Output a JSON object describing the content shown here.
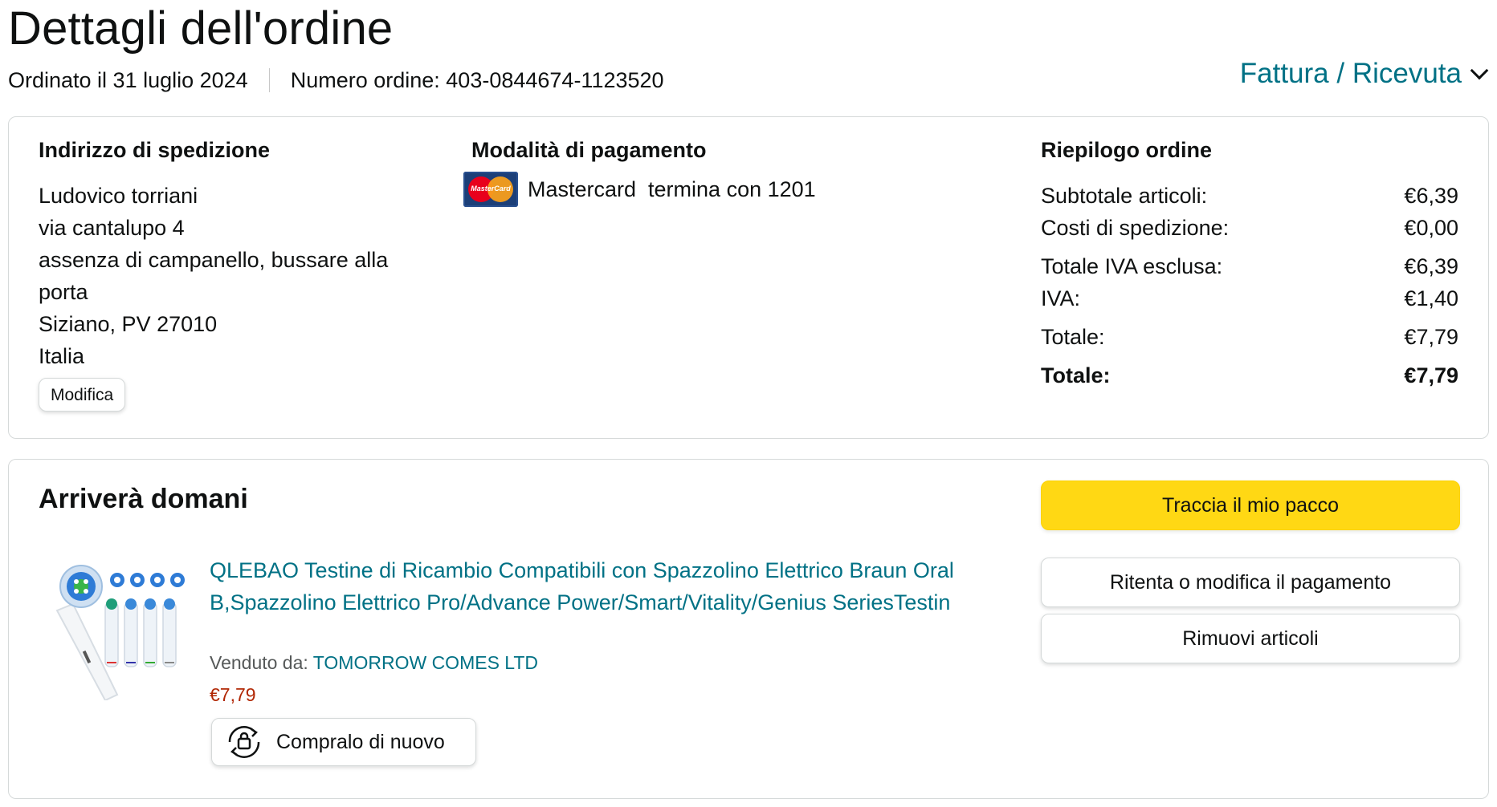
{
  "header": {
    "title": "Dettagli dell'ordine",
    "ordered_on": "Ordinato il 31 luglio 2024",
    "order_number": "Numero ordine: 403-0844674-1123520",
    "invoice_link": "Fattura / Ricevuta"
  },
  "shipping": {
    "heading": "Indirizzo di spedizione",
    "lines": [
      "Ludovico torriani",
      "via cantalupo 4",
      "assenza di campanello, bussare alla porta",
      "Siziano, PV 27010",
      "Italia"
    ],
    "edit_label": "Modifica"
  },
  "payment": {
    "heading": "Modalità di pagamento",
    "card_brand": "Mastercard",
    "card_desc": "Mastercard  termina con 1201",
    "card_logo_text": "MasterCard"
  },
  "summary": {
    "heading": "Riepilogo ordine",
    "rows": [
      {
        "label": "Subtotale articoli:",
        "value": "€6,39"
      },
      {
        "label": "Costi di spedizione:",
        "value": "€0,00"
      },
      {
        "label": "Totale IVA esclusa:",
        "value": "€6,39"
      },
      {
        "label": "IVA:",
        "value": "€1,40"
      },
      {
        "label": "Totale:",
        "value": "€7,79"
      }
    ],
    "grand_total": {
      "label": "Totale:",
      "value": "€7,79"
    }
  },
  "delivery": {
    "heading": "Arriverà domani",
    "product_title": "QLEBAO Testine di Ricambio Compatibili con Spazzolino Elettrico Braun Oral B,Spazzolino Elettrico Pro/Advance Power/Smart/Vitality/Genius SeriesTestin",
    "seller_label": "Venduto da:",
    "seller_name": "TOMORROW COMES LTD",
    "price": "€7,79",
    "buy_again_label": "Compralo di nuovo"
  },
  "actions": {
    "track": "Traccia il mio pacco",
    "retry_payment": "Ritenta o modifica il pagamento",
    "remove_items": "Rimuovi articoli"
  },
  "colors": {
    "link": "#007185",
    "price": "#b12704",
    "primary_button": "#ffd814",
    "border": "#d5d9d9"
  },
  "icons": [
    "chevron-down-icon",
    "mastercard-logo",
    "buy-again-icon"
  ]
}
